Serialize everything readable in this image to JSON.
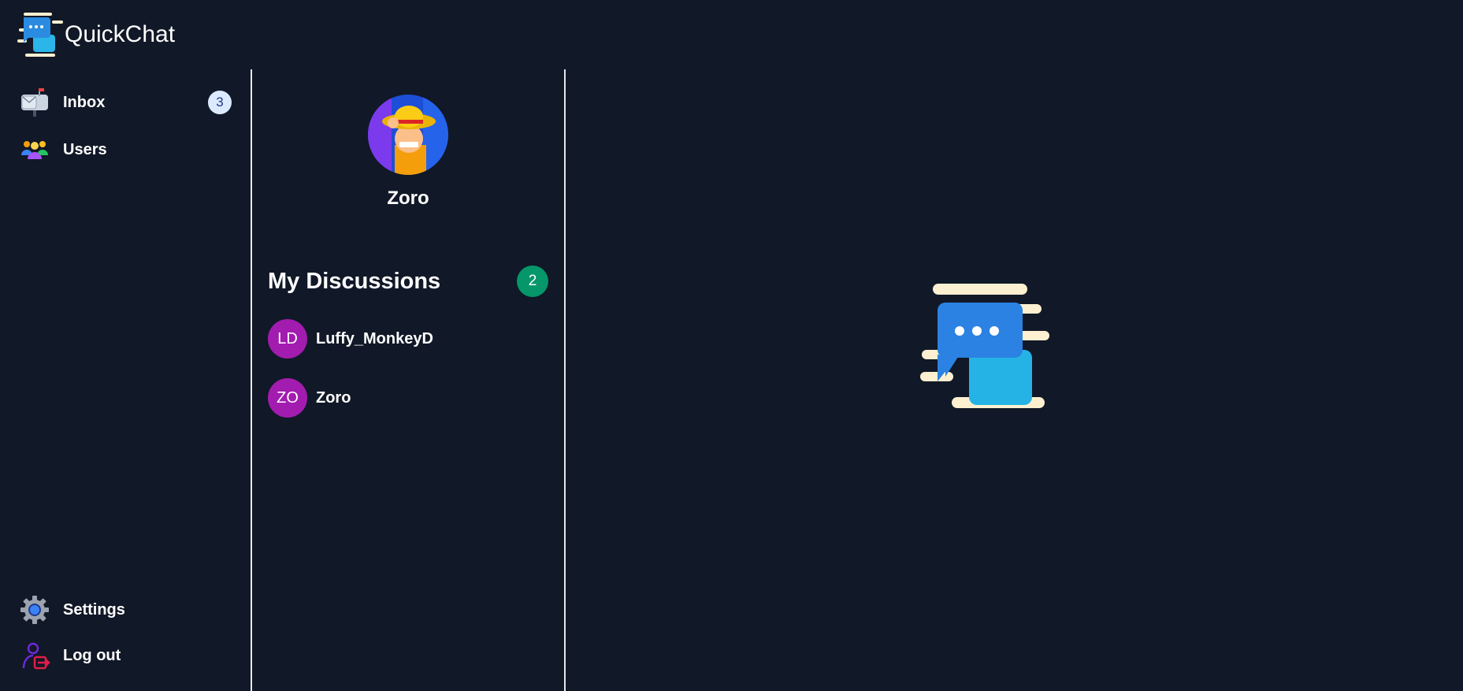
{
  "app": {
    "name": "QuickChat",
    "logo_icon": "chat-bubbles-logo"
  },
  "sidebar": {
    "items": [
      {
        "label": "Inbox",
        "icon": "mailbox-icon",
        "badge": "3"
      },
      {
        "label": "Users",
        "icon": "users-group-icon"
      }
    ],
    "bottom_items": [
      {
        "label": "Settings",
        "icon": "gear-icon"
      },
      {
        "label": "Log out",
        "icon": "logout-icon"
      }
    ]
  },
  "profile": {
    "name": "Zoro",
    "avatar_icon": "user-avatar-photo"
  },
  "discussions": {
    "title": "My Discussions",
    "count": "2",
    "items": [
      {
        "initials": "LD",
        "name": "Luffy_MonkeyD"
      },
      {
        "initials": "ZO",
        "name": "Zoro"
      }
    ]
  },
  "colors": {
    "background": "#111827",
    "divider": "#e5e7eb",
    "inbox_badge_bg": "#dbeafe",
    "count_badge_bg": "#059669",
    "initials_avatar_bg": "#a21caf"
  }
}
